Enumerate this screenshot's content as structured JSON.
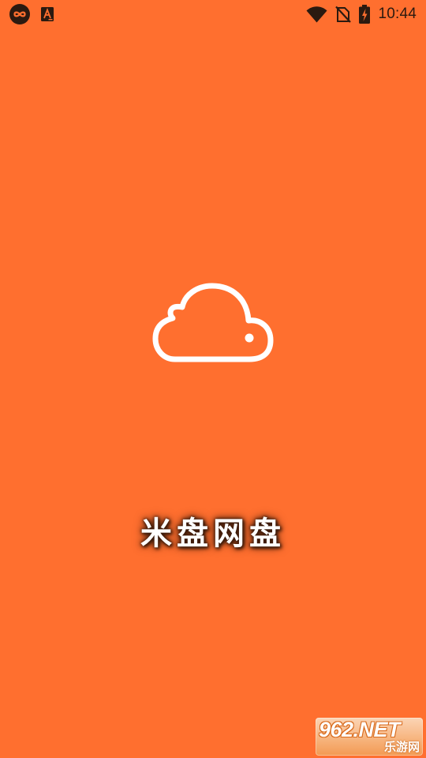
{
  "colors": {
    "background": "#ff6f2f",
    "status_icons": "#2b1a10",
    "logo_stroke": "#ffffff",
    "title_glow": "#3a1a0a"
  },
  "status_bar": {
    "time": "10:44",
    "left_icons": [
      "infinity-app-icon",
      "accessibility-a-icon"
    ],
    "right_icons": [
      "wifi-icon",
      "no-sim-icon",
      "battery-charging-icon"
    ]
  },
  "splash": {
    "logo_icon": "cloud-icon",
    "app_name": "米盘网盘"
  },
  "watermark": {
    "brand": "962.NET",
    "site": "乐游网"
  }
}
